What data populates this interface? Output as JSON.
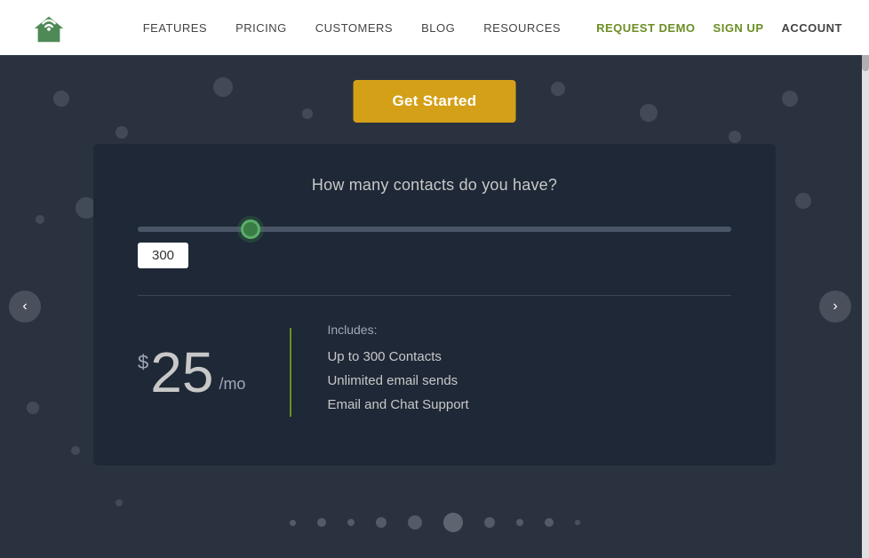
{
  "navbar": {
    "links": [
      {
        "label": "FEATURES",
        "id": "features"
      },
      {
        "label": "PRICING",
        "id": "pricing"
      },
      {
        "label": "CUSTOMERS",
        "id": "customers"
      },
      {
        "label": "BLOG",
        "id": "blog"
      },
      {
        "label": "RESOURCES",
        "id": "resources"
      }
    ],
    "actions": [
      {
        "label": "REQUEST DEMO",
        "id": "request-demo",
        "accent": true
      },
      {
        "label": "SIGN UP",
        "id": "sign-up",
        "accent": true
      },
      {
        "label": "ACCOUNT",
        "id": "account",
        "accent": false
      }
    ]
  },
  "hero": {
    "get_started_label": "Get Started"
  },
  "pricing": {
    "question": "How many contacts do you have?",
    "slider_value": "300",
    "slider_percent": 19,
    "includes_label": "Includes:",
    "currency_symbol": "$",
    "price": "25",
    "period": "/mo",
    "features": [
      "Up to 300 Contacts",
      "Unlimited email sends",
      "Email and Chat Support"
    ]
  },
  "decorative": {
    "bottom_dots": [
      3,
      5,
      4,
      6,
      8,
      12,
      6,
      4,
      5,
      3
    ]
  }
}
